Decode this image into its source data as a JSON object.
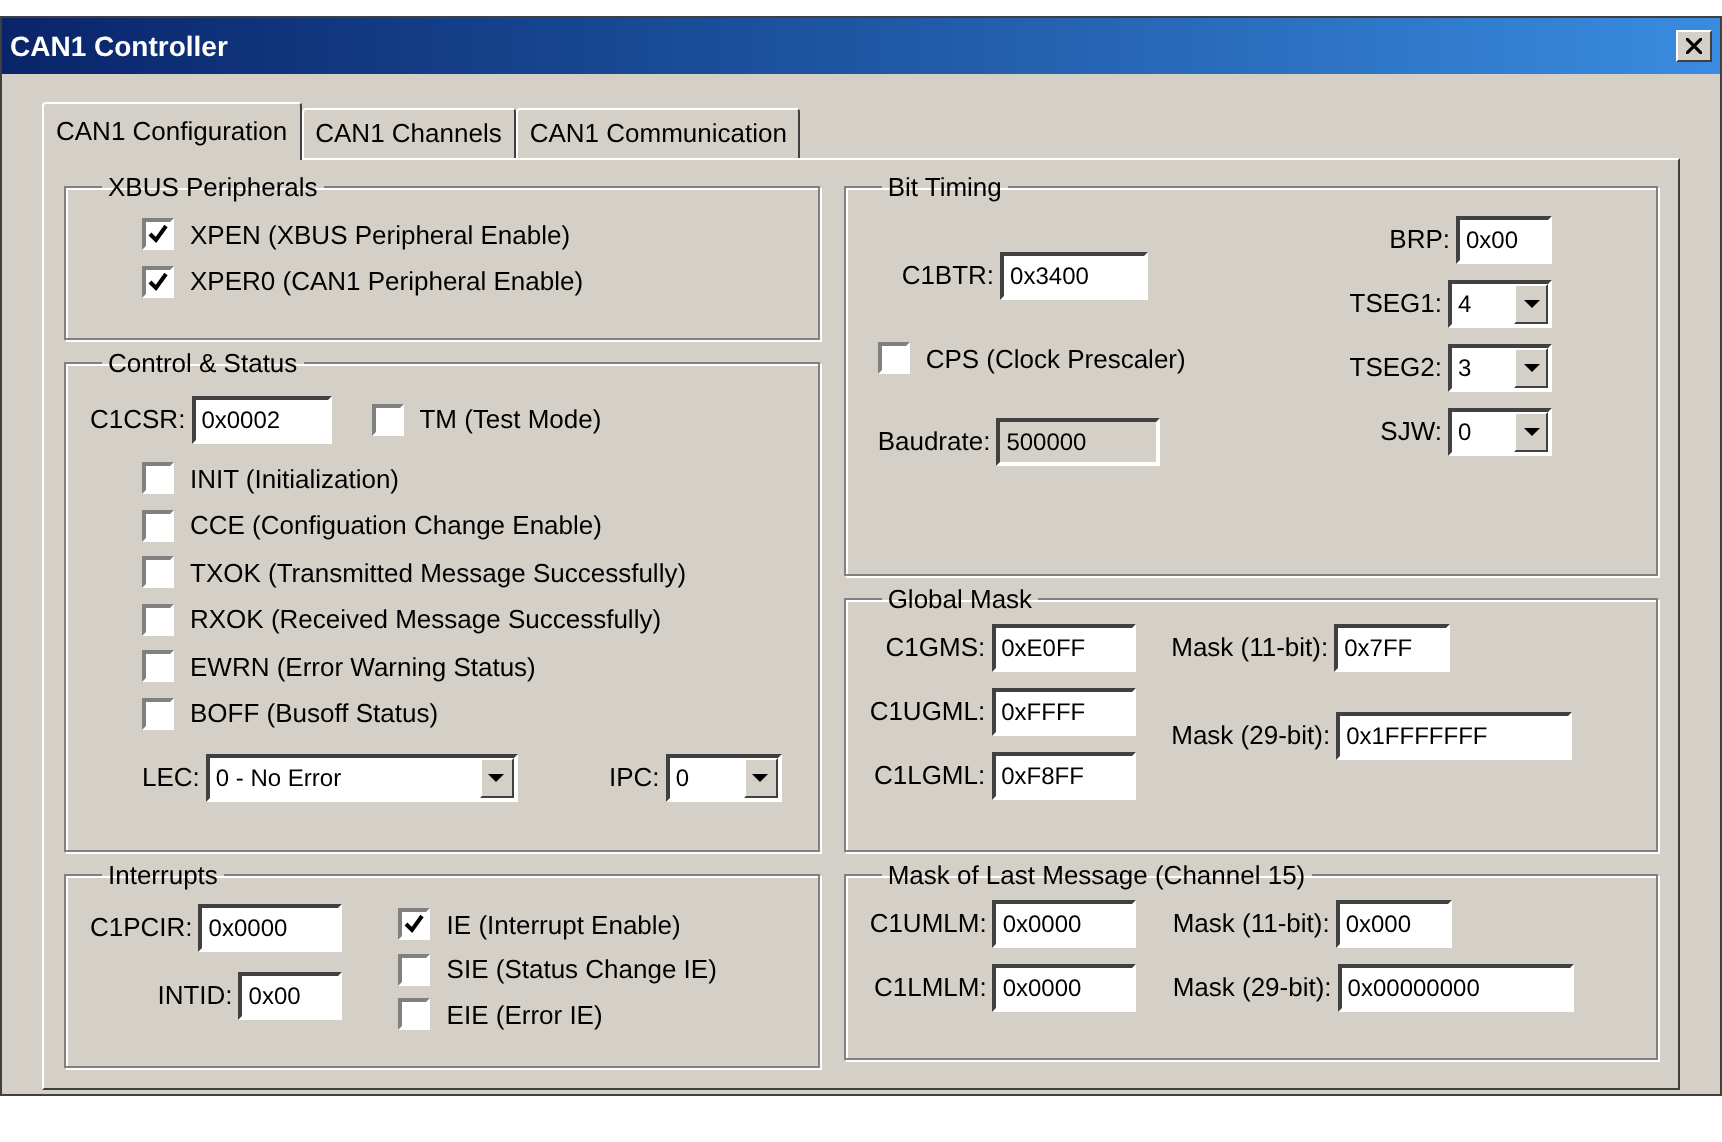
{
  "window": {
    "title": "CAN1 Controller"
  },
  "tabs": [
    {
      "label": "CAN1 Configuration",
      "selected": true
    },
    {
      "label": "CAN1 Channels",
      "selected": false
    },
    {
      "label": "CAN1 Communication",
      "selected": false
    }
  ],
  "xbus_peripherals": {
    "title": "XBUS Peripherals",
    "checkboxes": [
      {
        "label": "XPEN (XBUS Peripheral Enable)",
        "checked": true
      },
      {
        "label": "XPER0 (CAN1 Peripheral Enable)",
        "checked": true
      }
    ]
  },
  "control_status": {
    "title": "Control & Status",
    "c1csr": {
      "label": "C1CSR:",
      "value": "0x0002"
    },
    "test_mode": {
      "label": "TM (Test Mode)",
      "checked": false
    },
    "checkboxes": [
      {
        "label": "INIT (Initialization)",
        "checked": false
      },
      {
        "label": "CCE (Configuation Change Enable)",
        "checked": false
      },
      {
        "label": "TXOK (Transmitted Message Successfully)",
        "checked": false
      },
      {
        "label": "RXOK (Received Message Successfully)",
        "checked": false
      },
      {
        "label": "EWRN (Error Warning Status)",
        "checked": false
      },
      {
        "label": "BOFF (Busoff Status)",
        "checked": false
      }
    ],
    "lec": {
      "label": "LEC:",
      "value": "0 - No Error"
    },
    "ipc": {
      "label": "IPC:",
      "value": "0"
    }
  },
  "interrupts": {
    "title": "Interrupts",
    "fields": [
      {
        "label": "C1PCIR:",
        "value": "0x0000"
      },
      {
        "label": "INTID:",
        "value": "0x00"
      }
    ],
    "checkboxes": [
      {
        "label": "IE (Interrupt Enable)",
        "checked": true
      },
      {
        "label": "SIE (Status Change IE)",
        "checked": false
      },
      {
        "label": "EIE (Error IE)",
        "checked": false
      }
    ]
  },
  "bit_timing": {
    "title": "Bit Timing",
    "c1btr": {
      "label": "C1BTR:",
      "value": "0x3400"
    },
    "cps": {
      "label": "CPS (Clock Prescaler)",
      "checked": false
    },
    "baudrate": {
      "label": "Baudrate:",
      "value": "500000",
      "disabled": true
    },
    "brp": {
      "label": "BRP:",
      "value": "0x00"
    },
    "dropdowns": [
      {
        "label": "TSEG1:",
        "value": "4"
      },
      {
        "label": "TSEG2:",
        "value": "3"
      },
      {
        "label": "SJW:",
        "value": "0"
      }
    ]
  },
  "global_mask": {
    "title": "Global Mask",
    "registers": [
      {
        "label": "C1GMS:",
        "value": "0xE0FF"
      },
      {
        "label": "C1UGML:",
        "value": "0xFFFF"
      },
      {
        "label": "C1LGML:",
        "value": "0xF8FF"
      }
    ],
    "masks": [
      {
        "label": "Mask (11-bit):",
        "value": "0x7FF"
      },
      {
        "label": "Mask (29-bit):",
        "value": "0x1FFFFFFF"
      }
    ]
  },
  "last_message_mask": {
    "title": "Mask of Last Message (Channel 15)",
    "registers": [
      {
        "label": "C1UMLM:",
        "value": "0x0000"
      },
      {
        "label": "C1LMLM:",
        "value": "0x0000"
      }
    ],
    "masks": [
      {
        "label": "Mask (11-bit):",
        "value": "0x000"
      },
      {
        "label": "Mask (29-bit):",
        "value": "0x00000000"
      }
    ]
  }
}
